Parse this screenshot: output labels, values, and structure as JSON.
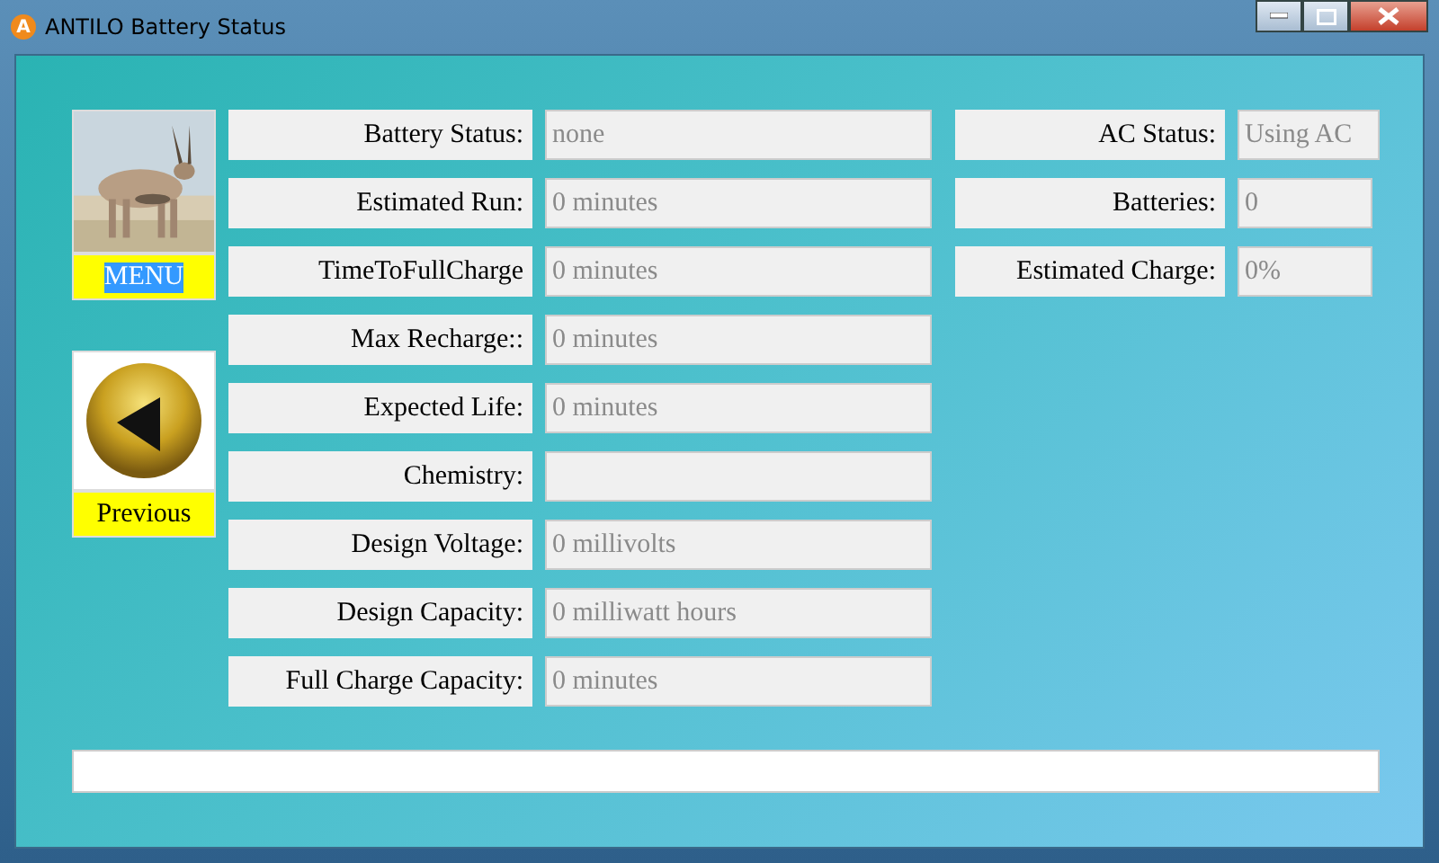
{
  "window": {
    "title": "ANTILO Battery Status",
    "app_icon": "A"
  },
  "sidebar": {
    "menu": {
      "label": "MENU",
      "highlighted": true
    },
    "previous": {
      "label": "Previous"
    }
  },
  "fields": [
    {
      "label": "Battery Status:",
      "value": "none"
    },
    {
      "label": "Estimated Run:",
      "value": "0 minutes"
    },
    {
      "label": "TimeToFullCharge",
      "value": "0 minutes"
    },
    {
      "label": "Max Recharge::",
      "value": "0 minutes"
    },
    {
      "label": "Expected Life:",
      "value": "0 minutes"
    },
    {
      "label": "Chemistry:"
    },
    {
      "label": "Design Voltage:",
      "value": "0 millivolts"
    },
    {
      "label": "Design Capacity:",
      "value": "0 milliwatt hours"
    },
    {
      "label": "Full Charge Capacity:",
      "value": "0 minutes"
    }
  ],
  "right_fields": [
    {
      "label": "AC Status:",
      "value": "Using AC"
    },
    {
      "label": "Batteries:",
      "value": "0"
    },
    {
      "label": "Estimated Charge:",
      "value": "0%"
    }
  ]
}
